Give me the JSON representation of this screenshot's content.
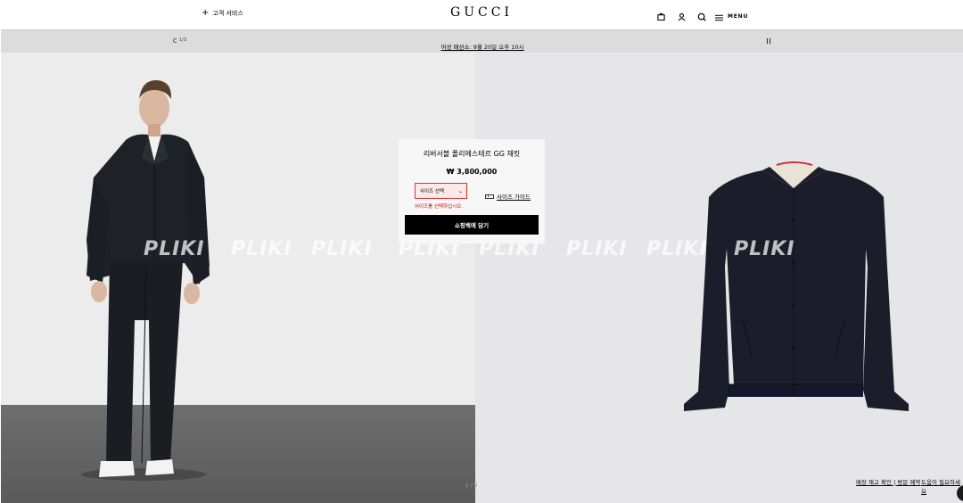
{
  "header": {
    "customer_service": "고객 서비스",
    "logo": "GUCCI",
    "menu_label": "MENU"
  },
  "banner": {
    "counter": "1/3",
    "link_text": "여성 패션쇼: 9월 20일 오후 10시"
  },
  "product": {
    "name": "리버서블 폴리에스테르 GG 재킷",
    "price": "₩ 3,800,000",
    "size_select": "사이즈 선택",
    "size_guide": "사이즈 가이드",
    "size_error": "사이즈를 선택하십시오.",
    "add_to_bag": "쇼핑백에 담기"
  },
  "gallery": {
    "pager": "1 / 9"
  },
  "footer": {
    "store_link": "매장 재고 확인 | 방문 예약",
    "help_link": "도움이 필요하세요"
  },
  "watermark": [
    "PLIKI",
    "PLIKI",
    "PLIKI",
    "PLIKI",
    "PLIKI",
    "PLIKI",
    "PLIKI",
    "PLIKI"
  ],
  "icons": [
    "plus-icon",
    "shopping-bag-icon",
    "account-icon",
    "search-icon",
    "menu-icon",
    "pause-icon",
    "ruler-icon",
    "chevron-down-icon",
    "chat-icon"
  ],
  "colors": {
    "error": "#cc0000",
    "button_bg": "#000000",
    "banner_bg": "#dcdcdc"
  }
}
